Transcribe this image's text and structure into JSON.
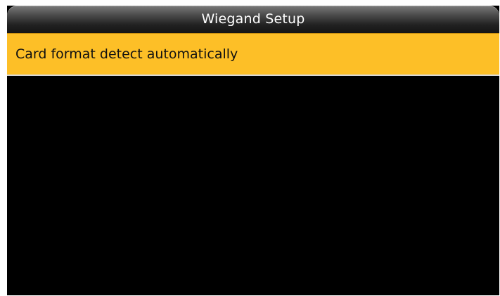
{
  "header": {
    "title": "Wiegand Setup"
  },
  "menu": {
    "items": [
      {
        "label": "Card format detect automatically",
        "selected": true
      }
    ]
  },
  "colors": {
    "background": "#000000",
    "selected_item": "#fdbf27",
    "title_text": "#ffffff",
    "item_text": "#111111"
  }
}
